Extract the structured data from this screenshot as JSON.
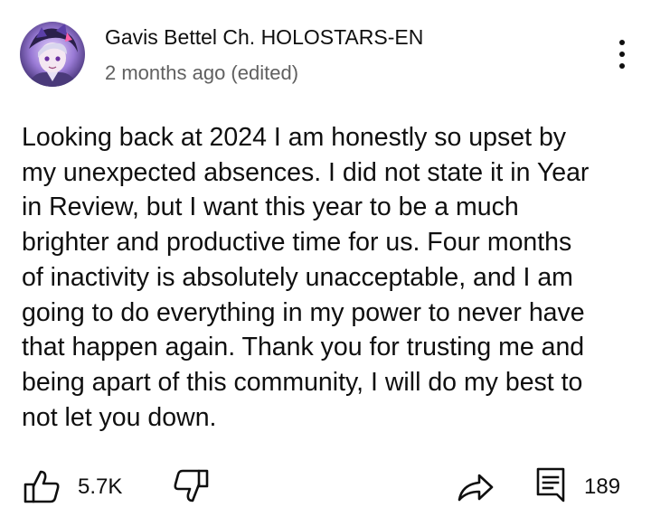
{
  "comment": {
    "author": "Gavis Bettel Ch. HOLOSTARS-EN",
    "timestamp": "2 months ago (edited)",
    "lines": [
      "Looking back at 2024 I am honestly so upset by",
      "my unexpected absences. I did not state it in Year",
      "in Review, but I want this year to be a much",
      "brighter and productive time for us. Four months",
      "of inactivity is absolutely unacceptable, and I am",
      "going to do everything in my power to never have",
      "that happen again. Thank you for trusting me and",
      "being apart of this community, I will do my best to",
      "not let you down."
    ]
  },
  "actions": {
    "like_count": "5.7K",
    "reply_count": "189",
    "icons": [
      "thumbs-up-icon",
      "thumbs-down-icon",
      "share-icon",
      "comment-icon",
      "more-vertical-icon"
    ]
  },
  "colors": {
    "text": "#0f0f0f",
    "secondary": "#606060",
    "background": "#ffffff"
  }
}
